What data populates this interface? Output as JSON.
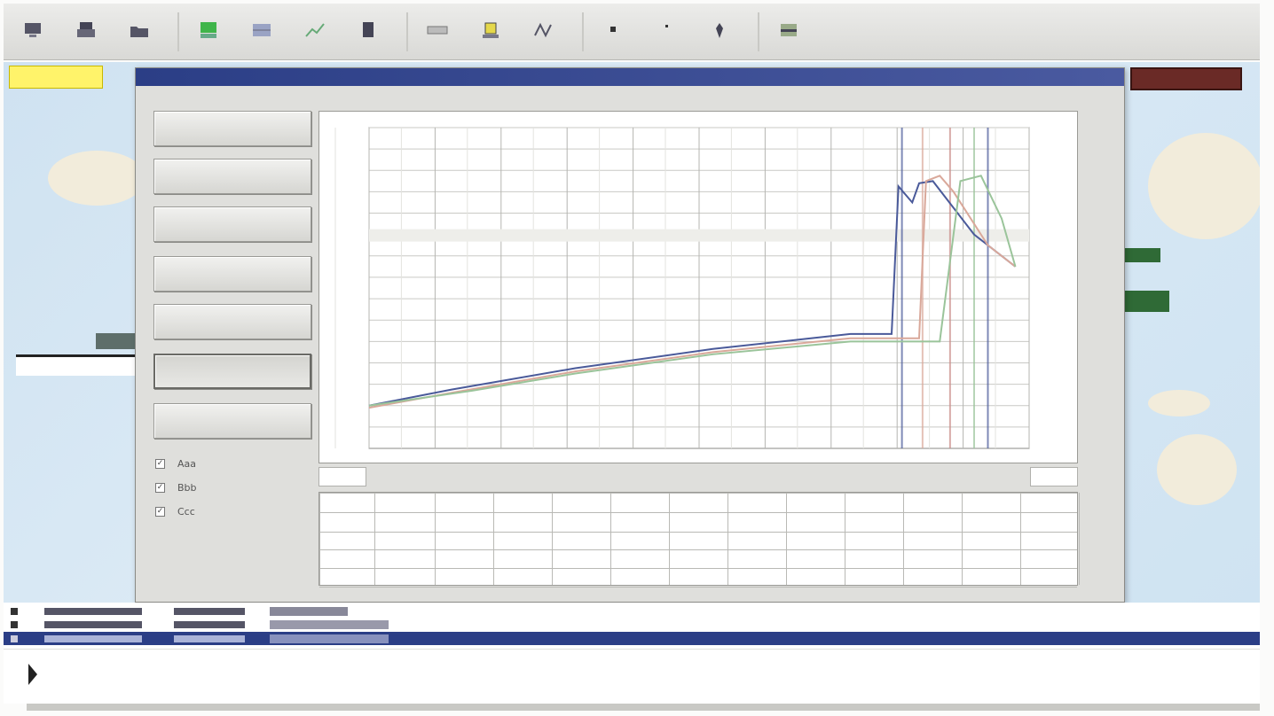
{
  "toolbar": {
    "buttons": [
      {
        "name": "tool-1"
      },
      {
        "name": "tool-2"
      },
      {
        "name": "tool-3"
      },
      {
        "name": "tool-4"
      },
      {
        "name": "tool-5"
      },
      {
        "name": "tool-6"
      },
      {
        "name": "tool-7"
      },
      {
        "name": "tool-8"
      },
      {
        "name": "tool-9"
      },
      {
        "name": "tool-10"
      },
      {
        "name": "tool-11"
      },
      {
        "name": "tool-12"
      },
      {
        "name": "tool-13"
      },
      {
        "name": "tool-14"
      }
    ]
  },
  "colors": {
    "accent": "#2b3e86",
    "status_chip": "#fff36a",
    "series_a": "#4a5a9a",
    "series_b": "#d9a89a",
    "series_c": "#9ac49a"
  },
  "side_panel": {
    "checkboxes": [
      {
        "label": "Aaa",
        "checked": true
      },
      {
        "label": "Bbb",
        "checked": true
      },
      {
        "label": "Ccc",
        "checked": true
      }
    ]
  },
  "chart_data": {
    "type": "line",
    "ylim": [
      0,
      300
    ],
    "y_ticks": [
      20,
      40,
      60,
      80,
      100,
      120,
      140,
      160,
      180,
      200,
      220,
      240,
      260,
      280,
      300
    ],
    "grid": true,
    "series": [
      {
        "color": "#4a5a9a",
        "x": [
          0,
          120,
          300,
          500,
          700,
          760,
          770,
          790,
          800,
          820,
          880,
          940
        ],
        "y": [
          40,
          55,
          75,
          93,
          107,
          107,
          245,
          230,
          248,
          250,
          200,
          170
        ]
      },
      {
        "color": "#d9a89a",
        "x": [
          0,
          120,
          300,
          500,
          700,
          800,
          810,
          830,
          850,
          900,
          940
        ],
        "y": [
          38,
          52,
          72,
          90,
          103,
          103,
          250,
          255,
          240,
          190,
          170
        ]
      },
      {
        "color": "#9ac49a",
        "x": [
          0,
          150,
          300,
          500,
          700,
          830,
          860,
          890,
          920,
          940
        ],
        "y": [
          40,
          54,
          70,
          88,
          100,
          100,
          250,
          255,
          215,
          170
        ]
      }
    ],
    "vertical_markers": [
      {
        "x": 775,
        "color": "#4a5a9a"
      },
      {
        "x": 805,
        "color": "#d9a89a"
      },
      {
        "x": 845,
        "color": "#c88a86"
      },
      {
        "x": 880,
        "color": "#9ac49a"
      },
      {
        "x": 900,
        "color": "#4a5a9a"
      }
    ]
  }
}
